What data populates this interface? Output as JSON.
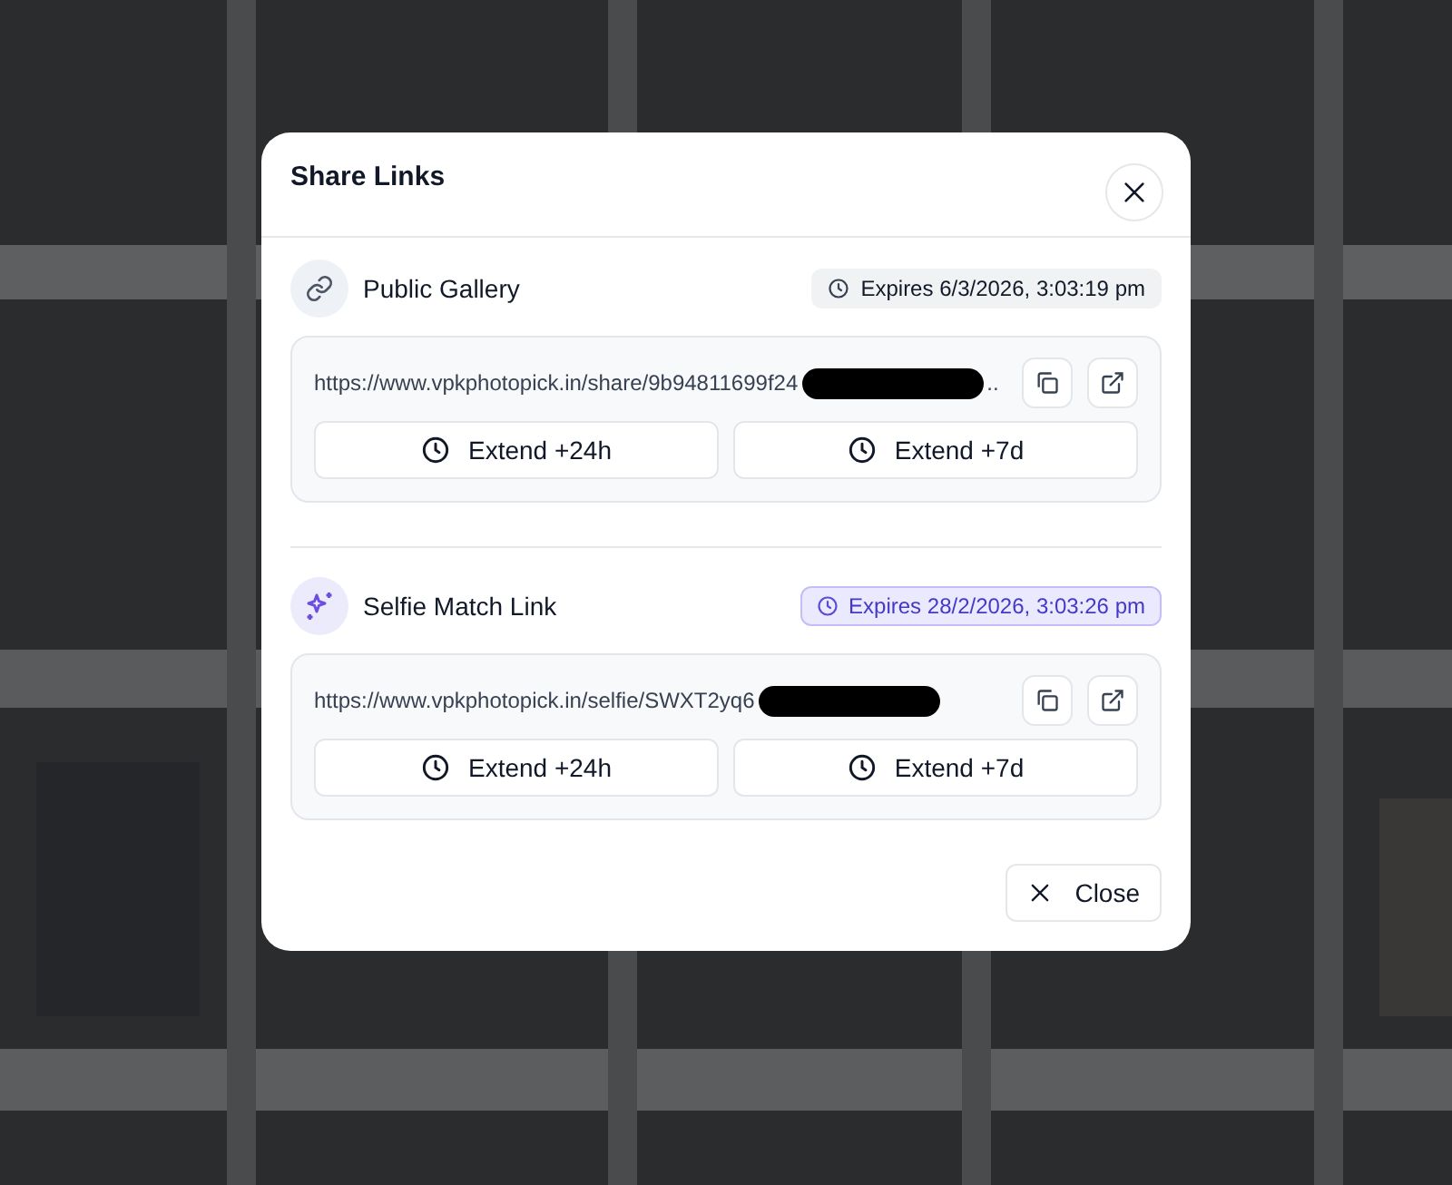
{
  "dialog": {
    "title": "Share Links"
  },
  "links": [
    {
      "kind": "gallery",
      "name": "Public Gallery",
      "expires": "Expires 6/3/2026, 3:03:19 pm",
      "url": "https://www.vpkphotopick.in/share/9b94811699f24",
      "url_end": "..",
      "actions": [
        "Extend +24h",
        "Extend +7d"
      ]
    },
    {
      "kind": "selfie",
      "name": "Selfie Match Link",
      "expires": "Expires 28/2/2026, 3:03:26 pm",
      "url": "https://www.vpkphotopick.in/selfie/SWXT2yq6",
      "actions": [
        "Extend +24h",
        "Extend +7d"
      ]
    }
  ],
  "footer": {
    "close": "Close"
  }
}
